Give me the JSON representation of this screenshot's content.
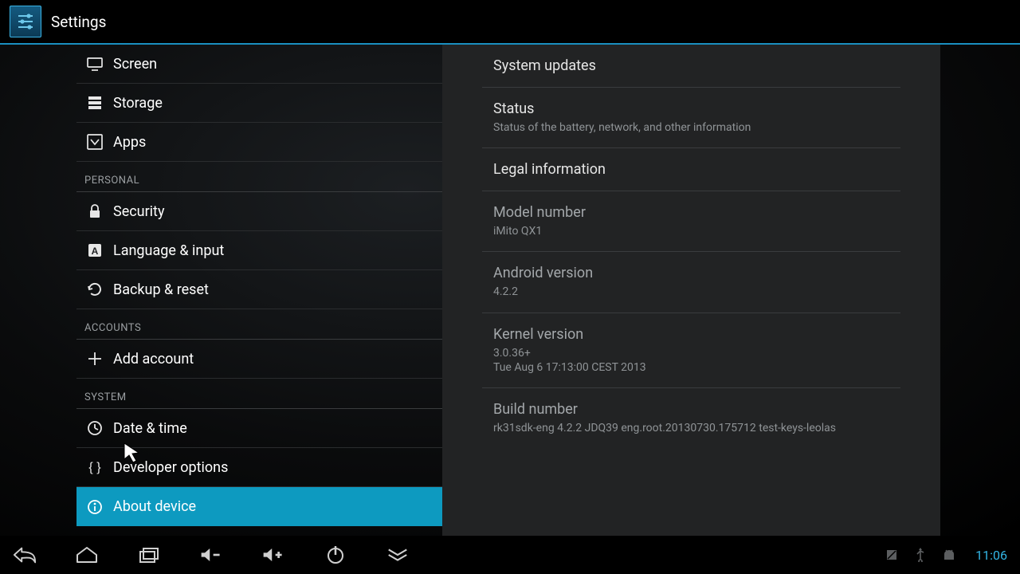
{
  "header": {
    "title": "Settings"
  },
  "sidebar": {
    "items": [
      {
        "kind": "item",
        "label": "Screen",
        "icon": "screen-icon"
      },
      {
        "kind": "item",
        "label": "Storage",
        "icon": "storage-icon"
      },
      {
        "kind": "item",
        "label": "Apps",
        "icon": "apps-icon"
      },
      {
        "kind": "section",
        "label": "PERSONAL"
      },
      {
        "kind": "item",
        "label": "Security",
        "icon": "lock-icon"
      },
      {
        "kind": "item",
        "label": "Language & input",
        "icon": "lang-icon"
      },
      {
        "kind": "item",
        "label": "Backup & reset",
        "icon": "backup-icon"
      },
      {
        "kind": "section",
        "label": "ACCOUNTS"
      },
      {
        "kind": "item",
        "label": "Add account",
        "icon": "plus-icon"
      },
      {
        "kind": "section",
        "label": "SYSTEM"
      },
      {
        "kind": "item",
        "label": "Date & time",
        "icon": "clock-icon"
      },
      {
        "kind": "item",
        "label": "Developer options",
        "icon": "braces-icon"
      },
      {
        "kind": "item",
        "label": "About device",
        "icon": "info-icon",
        "selected": true
      }
    ]
  },
  "main": {
    "rows": [
      {
        "title": "System updates",
        "interactable": true
      },
      {
        "title": "Status",
        "sub": "Status of the battery, network, and other information",
        "interactable": true
      },
      {
        "title": "Legal information",
        "interactable": true
      },
      {
        "title": "Model number",
        "sub": "iMito QX1",
        "dim": true,
        "interactable": false
      },
      {
        "title": "Android version",
        "sub": "4.2.2",
        "dim": true,
        "interactable": true
      },
      {
        "title": "Kernel version",
        "sub": "3.0.36+\nTue Aug 6 17:13:00 CEST 2013",
        "dim": true,
        "interactable": false
      },
      {
        "title": "Build number",
        "sub": "rk31sdk-eng 4.2.2 JDQ39 eng.root.20130730.175712 test-keys-leolas",
        "dim": true,
        "interactable": true
      }
    ]
  },
  "navbar": {
    "clock": "11:06"
  }
}
